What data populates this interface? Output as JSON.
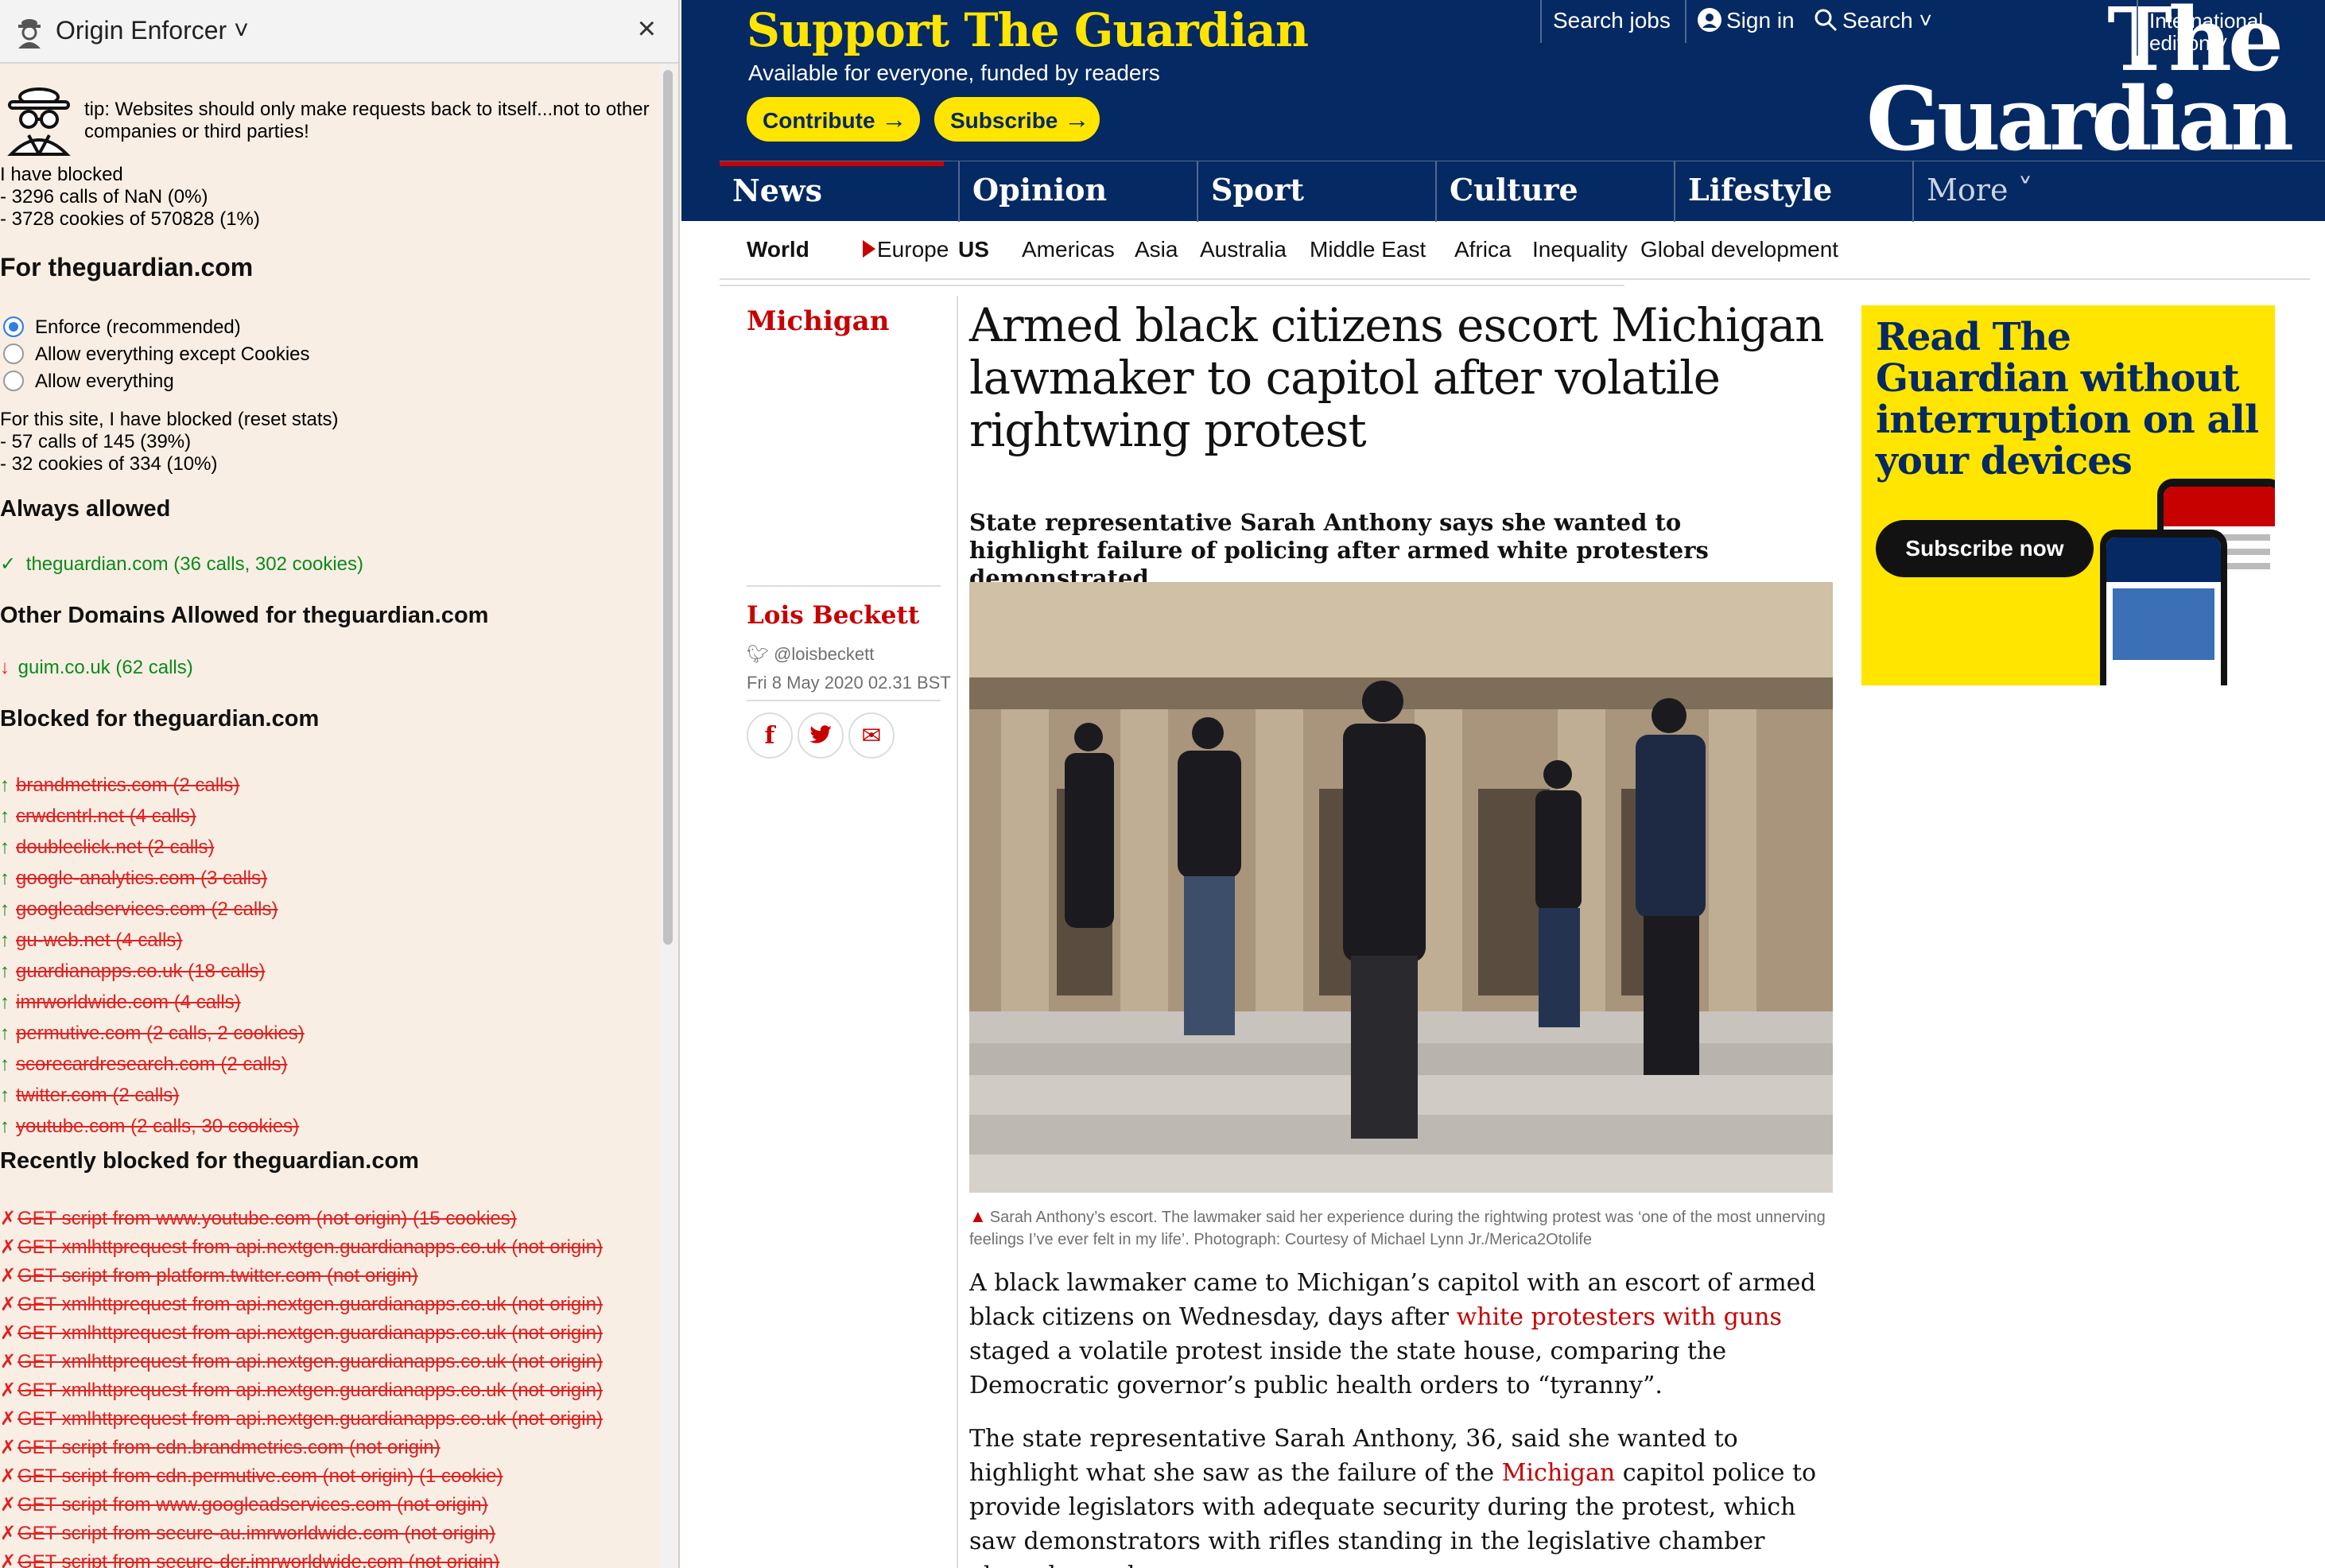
{
  "panel": {
    "title": "Origin Enforcer ˅",
    "close_label": "×",
    "tip": "tip: Websites should only make requests back to itself...not to other companies or third parties!",
    "global_stats": [
      "I have blocked",
      "- 3296 calls of NaN (0%)",
      "- 3728 cookies of 570828 (1%)"
    ],
    "site_heading": "For theguardian.com",
    "modes": [
      {
        "label": "Enforce (recommended)",
        "selected": true
      },
      {
        "label": "Allow everything except Cookies",
        "selected": false
      },
      {
        "label": "Allow everything",
        "selected": false
      }
    ],
    "site_stats": [
      "For this site, I have blocked (reset stats)",
      "- 57 calls of 145 (39%)",
      "- 32 cookies of 334 (10%)"
    ],
    "always_heading": "Always allowed",
    "always_item": {
      "mark": "✓",
      "text": "theguardian.com (36 calls, 302 cookies)"
    },
    "other_heading": "Other Domains Allowed for theguardian.com",
    "other_item": {
      "mark": "↓",
      "text": "guim.co.uk (62 calls)"
    },
    "blocked_heading": "Blocked for theguardian.com",
    "blocked_items": [
      "brandmetrics.com (2 calls)",
      "crwdcntrl.net (4 calls)",
      "doubleclick.net (2 calls)",
      "google-analytics.com (3 calls)",
      "googleadservices.com (2 calls)",
      "gu-web.net (4 calls)",
      "guardianapps.co.uk (18 calls)",
      "imrworldwide.com (4 calls)",
      "permutive.com (2 calls, 2 cookies)",
      "scorecardresearch.com (2 calls)",
      "twitter.com (2 calls)",
      "youtube.com (2 calls, 30 cookies)"
    ],
    "blocked_mark": "↑",
    "recent_heading": "Recently blocked for theguardian.com",
    "recent_mark": "✗",
    "recent_items": [
      "GET script from www.youtube.com (not origin) (15 cookies)",
      "GET xmlhttprequest from api.nextgen.guardianapps.co.uk (not origin)",
      "GET script from platform.twitter.com (not origin)",
      "GET xmlhttprequest from api.nextgen.guardianapps.co.uk (not origin)",
      "GET xmlhttprequest from api.nextgen.guardianapps.co.uk (not origin)",
      "GET xmlhttprequest from api.nextgen.guardianapps.co.uk (not origin)",
      "GET xmlhttprequest from api.nextgen.guardianapps.co.uk (not origin)",
      "GET xmlhttprequest from api.nextgen.guardianapps.co.uk (not origin)",
      "GET script from cdn.brandmetrics.com (not origin)",
      "GET script from cdn.permutive.com (not origin) (1 cookie)",
      "GET script from www.googleadservices.com (not origin)",
      "GET script from secure-au.imrworldwide.com (not origin)",
      "GET script from secure-dcr.imrworldwide.com (not origin)"
    ]
  },
  "guardian": {
    "support_title": "Support The Guardian",
    "support_sub": "Available for everyone, funded by readers",
    "contribute_label": "Contribute",
    "subscribe_label": "Subscribe",
    "arrow": "→",
    "search_jobs": "Search jobs",
    "sign_in": "Sign in",
    "search": "Search ˅",
    "edition": "International edition ˅",
    "logo_line1": "The",
    "logo_line2": "Guardian",
    "pillars": [
      "News",
      "Opinion",
      "Sport",
      "Culture",
      "Lifestyle",
      "More ˅"
    ],
    "subnav": [
      "World",
      "Europe",
      "US",
      "Americas",
      "Asia",
      "Australia",
      "Middle East",
      "Africa",
      "Inequality",
      "Global development"
    ],
    "section": "Michigan",
    "headline": "Armed black citizens escort Michigan lawmaker to capitol after volatile rightwing protest",
    "standfirst": "State representative Sarah Anthony says she wanted to highlight failure of policing after armed white protesters demonstrated",
    "byline": "Lois Beckett",
    "twitter": "@loisbeckett",
    "date": "Fri 8 May 2020 02.31 BST",
    "share_fb": "f",
    "share_tw": "t",
    "share_em": "✉",
    "caption": "Sarah Anthony’s escort. The lawmaker said her experience during the rightwing protest was ‘one of the most unnerving feelings I’ve ever felt in my life’. Photograph: Courtesy of Michael Lynn Jr./Merica2Otolife",
    "para1_a": "A black lawmaker came to Michigan’s capitol with an escort of armed black citizens on Wednesday, days after ",
    "para1_link": "white protesters with guns",
    "para1_b": " staged a volatile protest inside the state house, comparing the Democratic governor’s public health orders to “tyranny”.",
    "para2_a": "The state representative Sarah Anthony, 36, said she wanted to highlight what she saw as the failure of the ",
    "para2_link": "Michigan",
    "para2_b": " capitol police to provide legislators with adequate security during the protest, which saw demonstrators with rifles standing in the legislative chamber above lawmakers.",
    "ad_title": "Read The Guardian without interruption on all your devices",
    "ad_button": "Subscribe now"
  },
  "colors": {
    "guardian_blue": "#052962",
    "guardian_yellow": "#ffe500",
    "guardian_red": "#c70000",
    "blocked_red": "#e02020",
    "allowed_green": "#0a8a1a"
  }
}
